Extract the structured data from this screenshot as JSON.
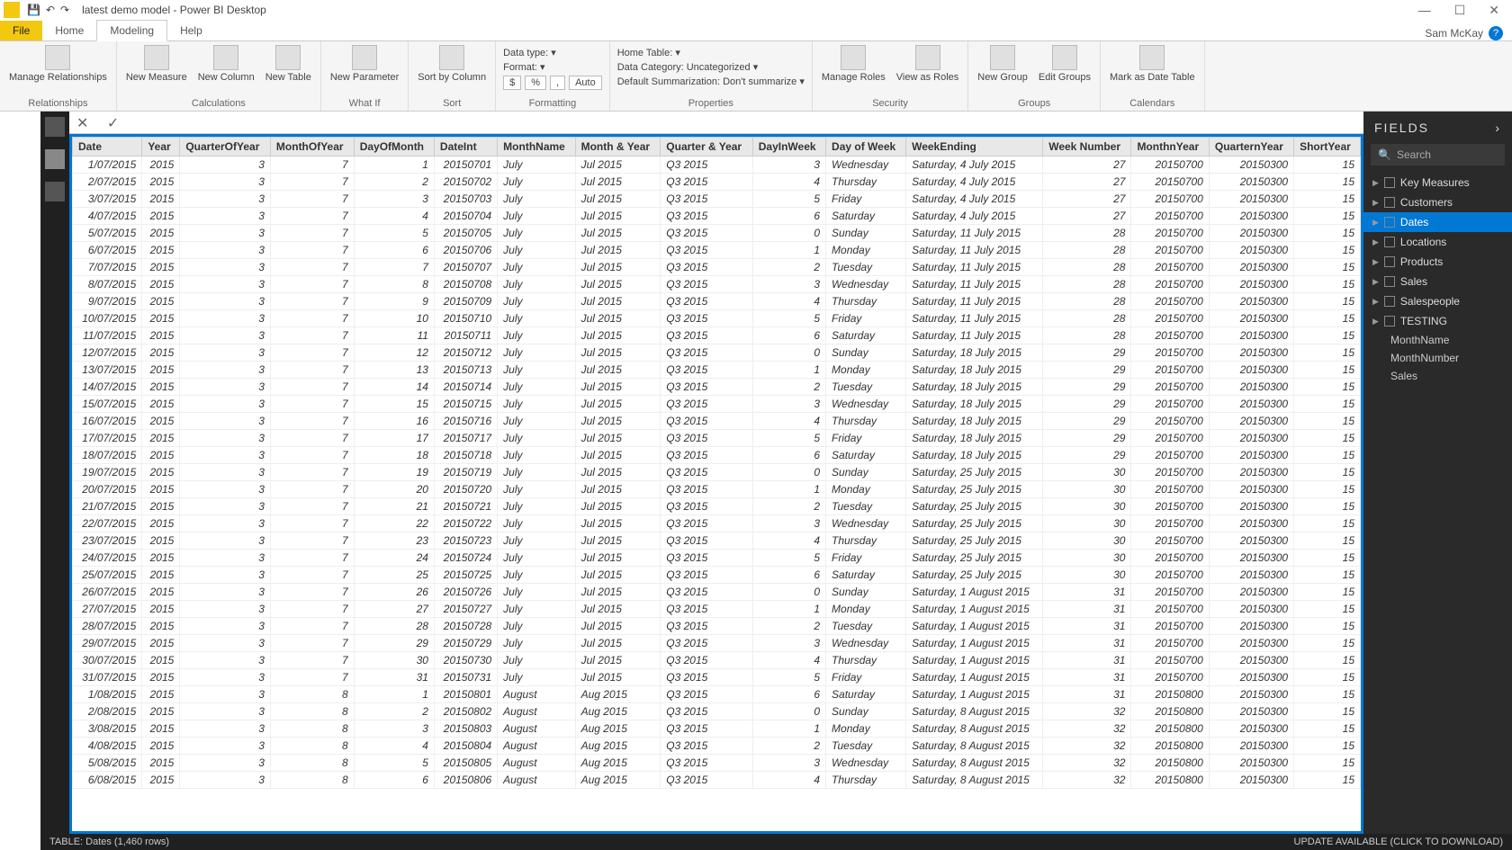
{
  "title": "latest demo model - Power BI Desktop",
  "user": "Sam McKay",
  "menutabs": {
    "file": "File",
    "home": "Home",
    "modeling": "Modeling",
    "help": "Help"
  },
  "ribbon": {
    "relationships": {
      "label": "Relationships",
      "manage": "Manage\nRelationships"
    },
    "calculations": {
      "label": "Calculations",
      "measure": "New\nMeasure",
      "column": "New\nColumn",
      "table": "New\nTable"
    },
    "whatif": {
      "label": "What If",
      "param": "New\nParameter"
    },
    "sort": {
      "label": "Sort",
      "sortby": "Sort by\nColumn"
    },
    "formatting": {
      "label": "Formatting",
      "datatype": "Data type: ",
      "format": "Format: ",
      "auto": "Auto"
    },
    "properties": {
      "label": "Properties",
      "hometable": "Home Table: ",
      "datacat": "Data Category: Uncategorized",
      "summ": "Default Summarization: Don't summarize"
    },
    "security": {
      "label": "Security",
      "manage": "Manage\nRoles",
      "view": "View as\nRoles"
    },
    "groups": {
      "label": "Groups",
      "new": "New\nGroup",
      "edit": "Edit\nGroups"
    },
    "calendars": {
      "label": "Calendars",
      "mark": "Mark as\nDate Table"
    }
  },
  "columns": [
    "Date",
    "Year",
    "QuarterOfYear",
    "MonthOfYear",
    "DayOfMonth",
    "DateInt",
    "MonthName",
    "Month & Year",
    "Quarter & Year",
    "DayInWeek",
    "Day of Week",
    "WeekEnding",
    "Week Number",
    "MonthnYear",
    "QuarternYear",
    "ShortYear"
  ],
  "rows": [
    [
      "1/07/2015",
      "2015",
      "3",
      "7",
      "1",
      "20150701",
      "July",
      "Jul 2015",
      "Q3 2015",
      "3",
      "Wednesday",
      "Saturday, 4 July 2015",
      "27",
      "20150700",
      "20150300",
      "15"
    ],
    [
      "2/07/2015",
      "2015",
      "3",
      "7",
      "2",
      "20150702",
      "July",
      "Jul 2015",
      "Q3 2015",
      "4",
      "Thursday",
      "Saturday, 4 July 2015",
      "27",
      "20150700",
      "20150300",
      "15"
    ],
    [
      "3/07/2015",
      "2015",
      "3",
      "7",
      "3",
      "20150703",
      "July",
      "Jul 2015",
      "Q3 2015",
      "5",
      "Friday",
      "Saturday, 4 July 2015",
      "27",
      "20150700",
      "20150300",
      "15"
    ],
    [
      "4/07/2015",
      "2015",
      "3",
      "7",
      "4",
      "20150704",
      "July",
      "Jul 2015",
      "Q3 2015",
      "6",
      "Saturday",
      "Saturday, 4 July 2015",
      "27",
      "20150700",
      "20150300",
      "15"
    ],
    [
      "5/07/2015",
      "2015",
      "3",
      "7",
      "5",
      "20150705",
      "July",
      "Jul 2015",
      "Q3 2015",
      "0",
      "Sunday",
      "Saturday, 11 July 2015",
      "28",
      "20150700",
      "20150300",
      "15"
    ],
    [
      "6/07/2015",
      "2015",
      "3",
      "7",
      "6",
      "20150706",
      "July",
      "Jul 2015",
      "Q3 2015",
      "1",
      "Monday",
      "Saturday, 11 July 2015",
      "28",
      "20150700",
      "20150300",
      "15"
    ],
    [
      "7/07/2015",
      "2015",
      "3",
      "7",
      "7",
      "20150707",
      "July",
      "Jul 2015",
      "Q3 2015",
      "2",
      "Tuesday",
      "Saturday, 11 July 2015",
      "28",
      "20150700",
      "20150300",
      "15"
    ],
    [
      "8/07/2015",
      "2015",
      "3",
      "7",
      "8",
      "20150708",
      "July",
      "Jul 2015",
      "Q3 2015",
      "3",
      "Wednesday",
      "Saturday, 11 July 2015",
      "28",
      "20150700",
      "20150300",
      "15"
    ],
    [
      "9/07/2015",
      "2015",
      "3",
      "7",
      "9",
      "20150709",
      "July",
      "Jul 2015",
      "Q3 2015",
      "4",
      "Thursday",
      "Saturday, 11 July 2015",
      "28",
      "20150700",
      "20150300",
      "15"
    ],
    [
      "10/07/2015",
      "2015",
      "3",
      "7",
      "10",
      "20150710",
      "July",
      "Jul 2015",
      "Q3 2015",
      "5",
      "Friday",
      "Saturday, 11 July 2015",
      "28",
      "20150700",
      "20150300",
      "15"
    ],
    [
      "11/07/2015",
      "2015",
      "3",
      "7",
      "11",
      "20150711",
      "July",
      "Jul 2015",
      "Q3 2015",
      "6",
      "Saturday",
      "Saturday, 11 July 2015",
      "28",
      "20150700",
      "20150300",
      "15"
    ],
    [
      "12/07/2015",
      "2015",
      "3",
      "7",
      "12",
      "20150712",
      "July",
      "Jul 2015",
      "Q3 2015",
      "0",
      "Sunday",
      "Saturday, 18 July 2015",
      "29",
      "20150700",
      "20150300",
      "15"
    ],
    [
      "13/07/2015",
      "2015",
      "3",
      "7",
      "13",
      "20150713",
      "July",
      "Jul 2015",
      "Q3 2015",
      "1",
      "Monday",
      "Saturday, 18 July 2015",
      "29",
      "20150700",
      "20150300",
      "15"
    ],
    [
      "14/07/2015",
      "2015",
      "3",
      "7",
      "14",
      "20150714",
      "July",
      "Jul 2015",
      "Q3 2015",
      "2",
      "Tuesday",
      "Saturday, 18 July 2015",
      "29",
      "20150700",
      "20150300",
      "15"
    ],
    [
      "15/07/2015",
      "2015",
      "3",
      "7",
      "15",
      "20150715",
      "July",
      "Jul 2015",
      "Q3 2015",
      "3",
      "Wednesday",
      "Saturday, 18 July 2015",
      "29",
      "20150700",
      "20150300",
      "15"
    ],
    [
      "16/07/2015",
      "2015",
      "3",
      "7",
      "16",
      "20150716",
      "July",
      "Jul 2015",
      "Q3 2015",
      "4",
      "Thursday",
      "Saturday, 18 July 2015",
      "29",
      "20150700",
      "20150300",
      "15"
    ],
    [
      "17/07/2015",
      "2015",
      "3",
      "7",
      "17",
      "20150717",
      "July",
      "Jul 2015",
      "Q3 2015",
      "5",
      "Friday",
      "Saturday, 18 July 2015",
      "29",
      "20150700",
      "20150300",
      "15"
    ],
    [
      "18/07/2015",
      "2015",
      "3",
      "7",
      "18",
      "20150718",
      "July",
      "Jul 2015",
      "Q3 2015",
      "6",
      "Saturday",
      "Saturday, 18 July 2015",
      "29",
      "20150700",
      "20150300",
      "15"
    ],
    [
      "19/07/2015",
      "2015",
      "3",
      "7",
      "19",
      "20150719",
      "July",
      "Jul 2015",
      "Q3 2015",
      "0",
      "Sunday",
      "Saturday, 25 July 2015",
      "30",
      "20150700",
      "20150300",
      "15"
    ],
    [
      "20/07/2015",
      "2015",
      "3",
      "7",
      "20",
      "20150720",
      "July",
      "Jul 2015",
      "Q3 2015",
      "1",
      "Monday",
      "Saturday, 25 July 2015",
      "30",
      "20150700",
      "20150300",
      "15"
    ],
    [
      "21/07/2015",
      "2015",
      "3",
      "7",
      "21",
      "20150721",
      "July",
      "Jul 2015",
      "Q3 2015",
      "2",
      "Tuesday",
      "Saturday, 25 July 2015",
      "30",
      "20150700",
      "20150300",
      "15"
    ],
    [
      "22/07/2015",
      "2015",
      "3",
      "7",
      "22",
      "20150722",
      "July",
      "Jul 2015",
      "Q3 2015",
      "3",
      "Wednesday",
      "Saturday, 25 July 2015",
      "30",
      "20150700",
      "20150300",
      "15"
    ],
    [
      "23/07/2015",
      "2015",
      "3",
      "7",
      "23",
      "20150723",
      "July",
      "Jul 2015",
      "Q3 2015",
      "4",
      "Thursday",
      "Saturday, 25 July 2015",
      "30",
      "20150700",
      "20150300",
      "15"
    ],
    [
      "24/07/2015",
      "2015",
      "3",
      "7",
      "24",
      "20150724",
      "July",
      "Jul 2015",
      "Q3 2015",
      "5",
      "Friday",
      "Saturday, 25 July 2015",
      "30",
      "20150700",
      "20150300",
      "15"
    ],
    [
      "25/07/2015",
      "2015",
      "3",
      "7",
      "25",
      "20150725",
      "July",
      "Jul 2015",
      "Q3 2015",
      "6",
      "Saturday",
      "Saturday, 25 July 2015",
      "30",
      "20150700",
      "20150300",
      "15"
    ],
    [
      "26/07/2015",
      "2015",
      "3",
      "7",
      "26",
      "20150726",
      "July",
      "Jul 2015",
      "Q3 2015",
      "0",
      "Sunday",
      "Saturday, 1 August 2015",
      "31",
      "20150700",
      "20150300",
      "15"
    ],
    [
      "27/07/2015",
      "2015",
      "3",
      "7",
      "27",
      "20150727",
      "July",
      "Jul 2015",
      "Q3 2015",
      "1",
      "Monday",
      "Saturday, 1 August 2015",
      "31",
      "20150700",
      "20150300",
      "15"
    ],
    [
      "28/07/2015",
      "2015",
      "3",
      "7",
      "28",
      "20150728",
      "July",
      "Jul 2015",
      "Q3 2015",
      "2",
      "Tuesday",
      "Saturday, 1 August 2015",
      "31",
      "20150700",
      "20150300",
      "15"
    ],
    [
      "29/07/2015",
      "2015",
      "3",
      "7",
      "29",
      "20150729",
      "July",
      "Jul 2015",
      "Q3 2015",
      "3",
      "Wednesday",
      "Saturday, 1 August 2015",
      "31",
      "20150700",
      "20150300",
      "15"
    ],
    [
      "30/07/2015",
      "2015",
      "3",
      "7",
      "30",
      "20150730",
      "July",
      "Jul 2015",
      "Q3 2015",
      "4",
      "Thursday",
      "Saturday, 1 August 2015",
      "31",
      "20150700",
      "20150300",
      "15"
    ],
    [
      "31/07/2015",
      "2015",
      "3",
      "7",
      "31",
      "20150731",
      "July",
      "Jul 2015",
      "Q3 2015",
      "5",
      "Friday",
      "Saturday, 1 August 2015",
      "31",
      "20150700",
      "20150300",
      "15"
    ],
    [
      "1/08/2015",
      "2015",
      "3",
      "8",
      "1",
      "20150801",
      "August",
      "Aug 2015",
      "Q3 2015",
      "6",
      "Saturday",
      "Saturday, 1 August 2015",
      "31",
      "20150800",
      "20150300",
      "15"
    ],
    [
      "2/08/2015",
      "2015",
      "3",
      "8",
      "2",
      "20150802",
      "August",
      "Aug 2015",
      "Q3 2015",
      "0",
      "Sunday",
      "Saturday, 8 August 2015",
      "32",
      "20150800",
      "20150300",
      "15"
    ],
    [
      "3/08/2015",
      "2015",
      "3",
      "8",
      "3",
      "20150803",
      "August",
      "Aug 2015",
      "Q3 2015",
      "1",
      "Monday",
      "Saturday, 8 August 2015",
      "32",
      "20150800",
      "20150300",
      "15"
    ],
    [
      "4/08/2015",
      "2015",
      "3",
      "8",
      "4",
      "20150804",
      "August",
      "Aug 2015",
      "Q3 2015",
      "2",
      "Tuesday",
      "Saturday, 8 August 2015",
      "32",
      "20150800",
      "20150300",
      "15"
    ],
    [
      "5/08/2015",
      "2015",
      "3",
      "8",
      "5",
      "20150805",
      "August",
      "Aug 2015",
      "Q3 2015",
      "3",
      "Wednesday",
      "Saturday, 8 August 2015",
      "32",
      "20150800",
      "20150300",
      "15"
    ],
    [
      "6/08/2015",
      "2015",
      "3",
      "8",
      "6",
      "20150806",
      "August",
      "Aug 2015",
      "Q3 2015",
      "4",
      "Thursday",
      "Saturday, 8 August 2015",
      "32",
      "20150800",
      "20150300",
      "15"
    ]
  ],
  "fields": {
    "header": "FIELDS",
    "search": "Search",
    "tables": [
      "Key Measures",
      "Customers",
      "Dates",
      "Locations",
      "Products",
      "Sales",
      "Salespeople",
      "TESTING"
    ],
    "selected": "Dates",
    "testingFields": [
      "MonthName",
      "MonthNumber",
      "Sales"
    ]
  },
  "status": {
    "left": "TABLE: Dates (1,460 rows)",
    "right": "UPDATE AVAILABLE (CLICK TO DOWNLOAD)"
  }
}
